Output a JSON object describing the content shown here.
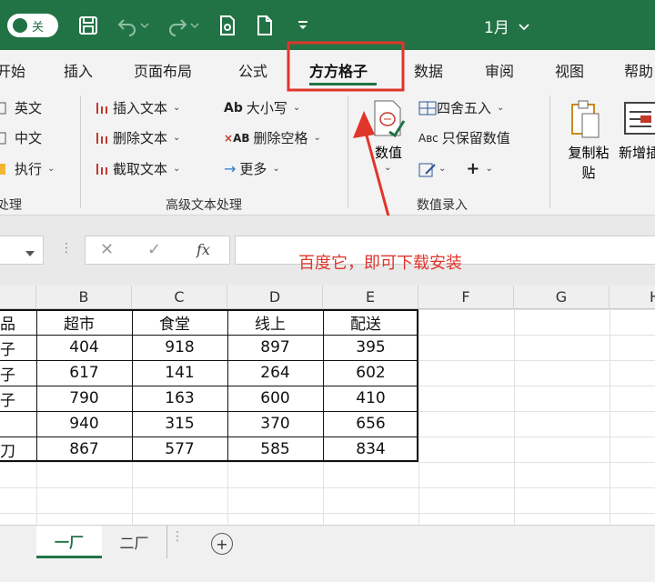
{
  "titlebar": {
    "autosave_label": "关",
    "document_title": "1月"
  },
  "tabs": [
    {
      "label": "开始",
      "active": false
    },
    {
      "label": "插入",
      "active": false
    },
    {
      "label": "页面布局",
      "active": false
    },
    {
      "label": "公式",
      "active": false
    },
    {
      "label": "方方格子",
      "active": true
    },
    {
      "label": "数据",
      "active": false
    },
    {
      "label": "审阅",
      "active": false
    },
    {
      "label": "视图",
      "active": false
    },
    {
      "label": "帮助",
      "active": false
    }
  ],
  "ribbon": {
    "left_group": {
      "items": [
        "英文",
        "中文",
        "执行"
      ],
      "label": "处理"
    },
    "text_group": {
      "insert_text": "插入文本",
      "delete_text": "删除文本",
      "cut_text": "截取文本",
      "case": "大小写",
      "delete_space": "删除空格",
      "more": "更多",
      "label": "高级文本处理"
    },
    "value_group": {
      "value_button": "数值",
      "round": "四舍五入",
      "keep_value": "只保留数值",
      "label": "数值录入"
    },
    "copy_group": {
      "copy_paste": "复制粘贴",
      "new_insert": "新增插入"
    }
  },
  "formula_bar": {
    "fx": "fx"
  },
  "annotation": "百度它，即可下载安装",
  "columns": [
    "B",
    "C",
    "D",
    "E",
    "F",
    "G",
    "H"
  ],
  "table": {
    "headers": [
      "品",
      "超市",
      "食堂",
      "线上",
      "配送"
    ],
    "rows": [
      [
        "子",
        "404",
        "918",
        "897",
        "395"
      ],
      [
        "子",
        "617",
        "141",
        "264",
        "602"
      ],
      [
        "子",
        "790",
        "163",
        "600",
        "410"
      ],
      [
        "",
        "940",
        "315",
        "370",
        "656"
      ],
      [
        "刀",
        "867",
        "577",
        "585",
        "834"
      ]
    ]
  },
  "sheets": [
    {
      "label": "一厂",
      "active": true
    },
    {
      "label": "二厂",
      "active": false
    }
  ],
  "colors": {
    "excel_green": "#217346",
    "annotation_red": "#e0352b"
  }
}
